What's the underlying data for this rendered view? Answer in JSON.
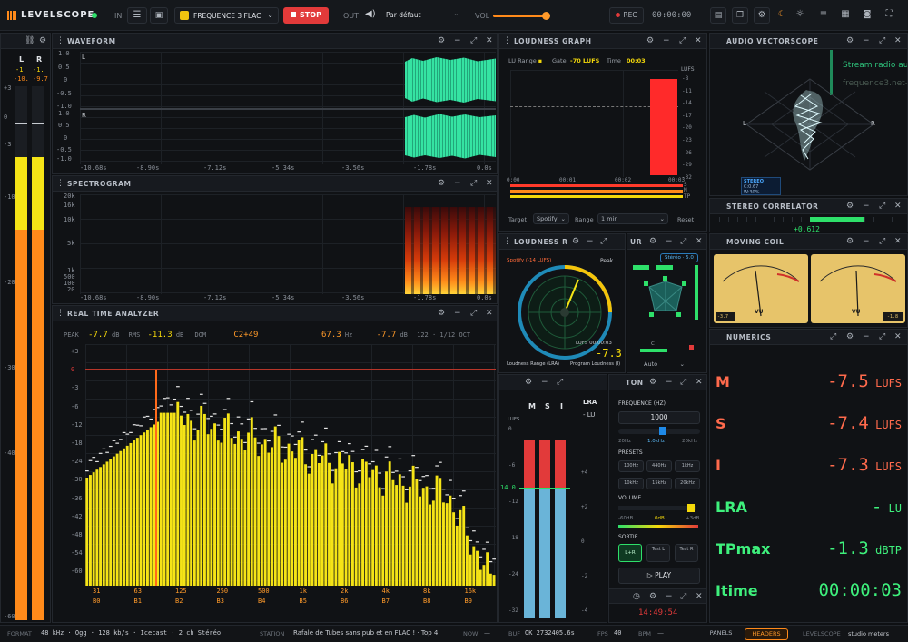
{
  "topbar": {
    "logo": "LEVELSCOPE",
    "in_label": "IN",
    "source": "FREQUENCE 3 FLAC",
    "stop": "STOP",
    "out_label": "OUT",
    "device": "Par défaut",
    "vol_label": "VOL",
    "rec": "REC",
    "timer": "00:00:00"
  },
  "meters": {
    "left": "L",
    "right": "R",
    "peak_l": "-1.",
    "peak_r": "-1.",
    "rms_l": "-10.",
    "rms_r": "-9.7",
    "scale": [
      "+3",
      "0",
      "-3",
      "-10",
      "-20",
      "-30",
      "-40",
      "-60"
    ]
  },
  "waveform": {
    "title": "WAVEFORM",
    "ticks_l": [
      "1.0",
      "0.5",
      "0",
      "-0.5",
      "-1.0"
    ],
    "ticks_r": [
      "1.0",
      "0.5",
      "0",
      "-0.5",
      "-1.0"
    ],
    "ch_l": "L",
    "ch_r": "R",
    "time": [
      "-10.68s",
      "-8.90s",
      "-7.12s",
      "-5.34s",
      "-3.56s",
      "-1.78s",
      "0.0s"
    ]
  },
  "spectrogram": {
    "title": "SPECTROGRAM",
    "freq": [
      "20k",
      "16k",
      "10k",
      "5k",
      "1k",
      "500",
      "100",
      "20"
    ],
    "time": [
      "-10.68s",
      "-8.90s",
      "-7.12s",
      "-5.34s",
      "-3.56s",
      "-1.78s",
      "0.0s"
    ]
  },
  "rta": {
    "title": "REAL TIME ANALYZER",
    "peak_label": "PEAK",
    "peak": "-7.7",
    "peak_unit": "dB",
    "rms_label": "RMS",
    "rms": "-11.3",
    "rms_unit": "dB",
    "dom_label": "DOM",
    "dom": "C2+49",
    "freq": "67.3",
    "freq_unit": "Hz",
    "db2": "-7.7",
    "db2_unit": "dB",
    "oct": "122 · 1/12 OCT",
    "yticks": [
      "+3",
      "0",
      "-3",
      "-6",
      "-12",
      "-18",
      "-24",
      "-30",
      "-36",
      "-42",
      "-48",
      "-54",
      "-60"
    ],
    "xfreq": [
      "31",
      "63",
      "125",
      "250",
      "500",
      "1k",
      "2k",
      "4k",
      "8k",
      "16k"
    ],
    "xnote": [
      "B0",
      "B1",
      "B2",
      "B3",
      "B4",
      "B5",
      "B6",
      "B7",
      "B8",
      "B9"
    ]
  },
  "loudness_graph": {
    "title": "LOUDNESS GRAPH",
    "lu_range": "LU Range",
    "gate_label": "Gate",
    "gate": "-70 LUFS",
    "time_label": "Time",
    "time": "00:03",
    "unit": "LUFS",
    "ticks": [
      "-8",
      "-11",
      "-14",
      "-17",
      "-20",
      "-23",
      "-26",
      "-29",
      "-32"
    ],
    "xticks": [
      "0:00",
      "00:01",
      "00:02",
      "00:03"
    ],
    "rows": [
      "S",
      "M",
      "TP"
    ],
    "target_label": "Target",
    "target": "Spotify",
    "range_label": "Range",
    "range": "1 min",
    "reset": "Reset"
  },
  "loudness_r": {
    "title": "LOUDNESS R",
    "spotify": "Spotify (-14 LUFS)",
    "peak": "Peak",
    "lufs": "LUFS 00:00:03",
    "value": "-7.3",
    "lra": "Loudness Range (LRA)",
    "prog": "Program Loudness (I)",
    "s_label": "S",
    "m_label": "M"
  },
  "surround": {
    "title": "UR",
    "badge": "Stéréo · 5.0",
    "mode": "Auto",
    "c_label": "C"
  },
  "vectorscope": {
    "title": "AUDIO VECTORSCOPE",
    "stream": "Stream radio au",
    "site": "frequence3.net-",
    "l": "L",
    "r": "R",
    "stereo": "STEREO",
    "c": "C:0.67",
    "w": "W:30%"
  },
  "correlator": {
    "title": "STEREO CORRELATOR",
    "value": "+0.612"
  },
  "moving_coil": {
    "title": "MOVING COIL",
    "vu": "VU",
    "l": "-3.7",
    "r": "-1.8"
  },
  "numerics": {
    "title": "NUMERICS",
    "rows": [
      {
        "label": "M",
        "value": "-7.5",
        "unit": "LUFS",
        "color": "#ff6a4c"
      },
      {
        "label": "S",
        "value": "-7.4",
        "unit": "LUFS",
        "color": "#ff6a4c"
      },
      {
        "label": "I",
        "value": "-7.3",
        "unit": "LUFS",
        "color": "#ff6a4c"
      },
      {
        "label": "LRA",
        "value": "-",
        "unit": "LU",
        "color": "#3ef07c"
      },
      {
        "label": "TPmax",
        "value": "-1.3",
        "unit": "dBTP",
        "color": "#3ef07c"
      },
      {
        "label": "Itime",
        "value": "00:00:03",
        "unit": "",
        "color": "#3ef07c"
      }
    ]
  },
  "bars_panel": {
    "m": "M",
    "s": "S",
    "i": "I",
    "lufs": "LUFS",
    "val": "14.0",
    "lra": "LRA",
    "lu": "- LU",
    "ticks": [
      "+4",
      "+2",
      "0",
      "-2",
      "-4"
    ],
    "lticks": [
      "0",
      "-6",
      "-12",
      "-18",
      "-24",
      "-32"
    ]
  },
  "tone": {
    "title": "TON",
    "freq_label": "FRÉQUENCE (HZ)",
    "freq": "1000",
    "f_min": "20Hz",
    "f_cur": "1.0kHz",
    "f_max": "20kHz",
    "presets_label": "PRESETS",
    "presets": [
      "100Hz",
      "440Hz",
      "1kHz",
      "10kHz",
      "15kHz",
      "20kHz"
    ],
    "volume_label": "VOLUME",
    "v_min": "-60dB",
    "v_cur": "0dB",
    "v_max": "+3dB",
    "sortie_label": "SORTIE",
    "out_lr": "L+R",
    "out_l": "Test L",
    "out_r": "Test R",
    "play": "PLAY"
  },
  "clock": {
    "time": "14:49:54"
  },
  "status": {
    "format_label": "FORMAT",
    "format": "48 kHz · Ogg · 128 kb/s · Icecast · 2 ch Stéréo",
    "station_label": "STATION",
    "station": "Rafale de Tubes sans pub et en FLAC ! · Top 4",
    "now_label": "NOW",
    "now": "—",
    "buf_label": "BUF",
    "buf": "OK 2732405.6s",
    "fps_label": "FPS",
    "fps": "40",
    "bpm_label": "BPM",
    "bpm": "—",
    "panels": "PANELS",
    "headers": "HEADERS",
    "brand": "LEVELSCOPE",
    "brand_sub": "studio meters"
  },
  "colors": {
    "accent": "#ff8a1a",
    "rta_bar": "#f5e416",
    "wave": "#35e3a2",
    "stop": "#e23a3a"
  }
}
